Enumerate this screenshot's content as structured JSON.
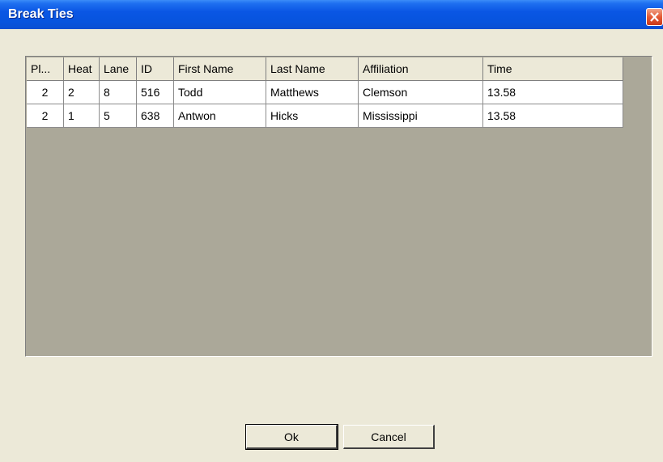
{
  "window": {
    "title": "Break Ties"
  },
  "table": {
    "columns": [
      "Pl...",
      "Heat",
      "Lane",
      "ID",
      "First Name",
      "Last Name",
      "Affiliation",
      "Time"
    ],
    "rows": [
      [
        "2",
        "2",
        "8",
        "516",
        "Todd",
        "Matthews",
        "Clemson",
        "13.58"
      ],
      [
        "2",
        "1",
        "5",
        "638",
        "Antwon",
        "Hicks",
        "Mississippi",
        "13.58"
      ]
    ]
  },
  "buttons": {
    "ok": "Ok",
    "cancel": "Cancel"
  },
  "colors": {
    "titlebar": "#0a56e4",
    "grid_background": "#aba899",
    "window_background": "#ece9d8"
  }
}
